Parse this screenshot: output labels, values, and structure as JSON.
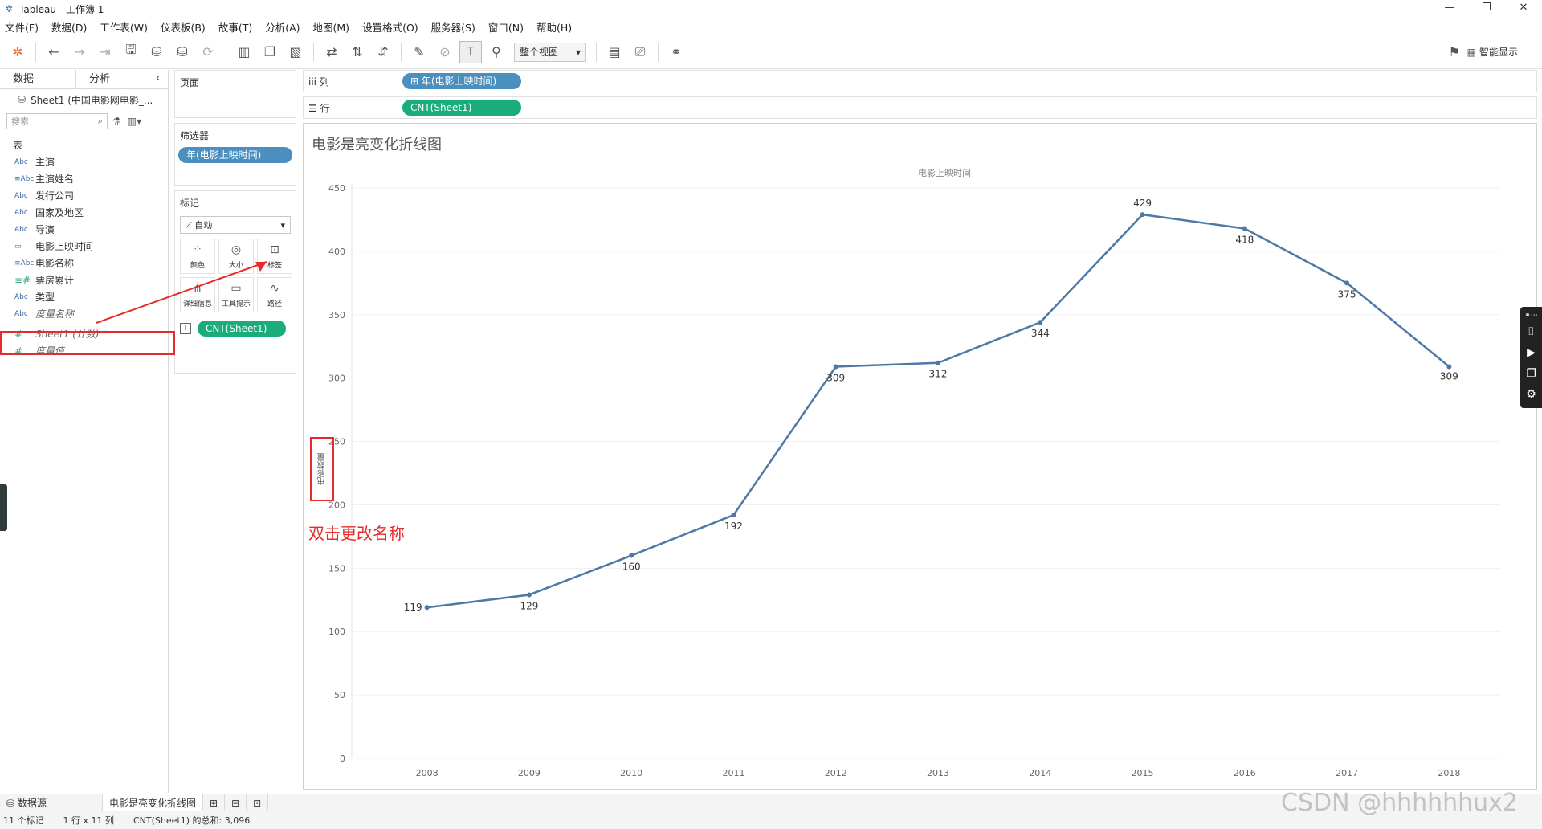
{
  "window": {
    "title": "Tableau - 工作簿 1",
    "controls": [
      "—",
      "❐",
      "✕"
    ]
  },
  "menu": [
    "文件(F)",
    "数据(D)",
    "工作表(W)",
    "仪表板(B)",
    "故事(T)",
    "分析(A)",
    "地图(M)",
    "设置格式(O)",
    "服务器(S)",
    "窗口(N)",
    "帮助(H)"
  ],
  "toolbar": {
    "view_select": "整个视图",
    "smart_display": "智能显示"
  },
  "data_panel": {
    "tab_data": "数据",
    "tab_analysis": "分析",
    "datasource": "Sheet1 (中国电影网电影_...",
    "search_placeholder": "搜索",
    "table_header": "表",
    "fields": [
      {
        "type": "Abc",
        "name": "主演"
      },
      {
        "type": "≡Abc",
        "name": "主演姓名"
      },
      {
        "type": "Abc",
        "name": "发行公司"
      },
      {
        "type": "Abc",
        "name": "国家及地区"
      },
      {
        "type": "Abc",
        "name": "导演"
      },
      {
        "type": "▭",
        "name": "电影上映时间"
      },
      {
        "type": "≡Abc",
        "name": "电影名称"
      },
      {
        "type": "≡#",
        "name": "票房累计"
      },
      {
        "type": "Abc",
        "name": "类型"
      },
      {
        "type": "Abc",
        "name": "度量名称"
      },
      {
        "type": "#",
        "name": "Sheet1 (计数)"
      },
      {
        "type": "#",
        "name": "度量值"
      }
    ]
  },
  "cards": {
    "pages": "页面",
    "filters": "筛选器",
    "filter_pill": "年(电影上映时间)",
    "marks": "标记",
    "mark_type": "自动",
    "mark_buttons": [
      "颜色",
      "大小",
      "标签",
      "详细信息",
      "工具提示",
      "路径"
    ],
    "mark_pill": "CNT(Sheet1)"
  },
  "shelves": {
    "columns_label": "列",
    "columns_pill": "年(电影上映时间)",
    "rows_label": "行",
    "rows_pill": "CNT(Sheet1)"
  },
  "view": {
    "title": "电影是亮变化折线图",
    "column_header": "电影上映时间",
    "axis_label": "电影数量",
    "annotation": "双击更改名称"
  },
  "chart_data": {
    "type": "line",
    "title": "电影是亮变化折线图",
    "xlabel": "电影上映时间",
    "ylabel": "电影数量",
    "x": [
      "2008",
      "2009",
      "2010",
      "2011",
      "2012",
      "2013",
      "2014",
      "2015",
      "2016",
      "2017",
      "2018"
    ],
    "values": [
      119,
      129,
      160,
      192,
      309,
      312,
      344,
      429,
      418,
      375,
      309
    ],
    "ylim": [
      0,
      450
    ],
    "yticks": [
      0,
      50,
      100,
      150,
      200,
      250,
      300,
      350,
      400,
      450
    ],
    "grid": true,
    "line_color": "#4e79a7"
  },
  "sheet_tabs": {
    "datasource": "数据源",
    "sheet": "电影是亮变化折线图"
  },
  "status": {
    "marks": "11 个标记",
    "dims": "1 行 x 11 列",
    "sum": "CNT(Sheet1) 的总和: 3,096"
  },
  "watermark": "CSDN @hhhhhhux2"
}
